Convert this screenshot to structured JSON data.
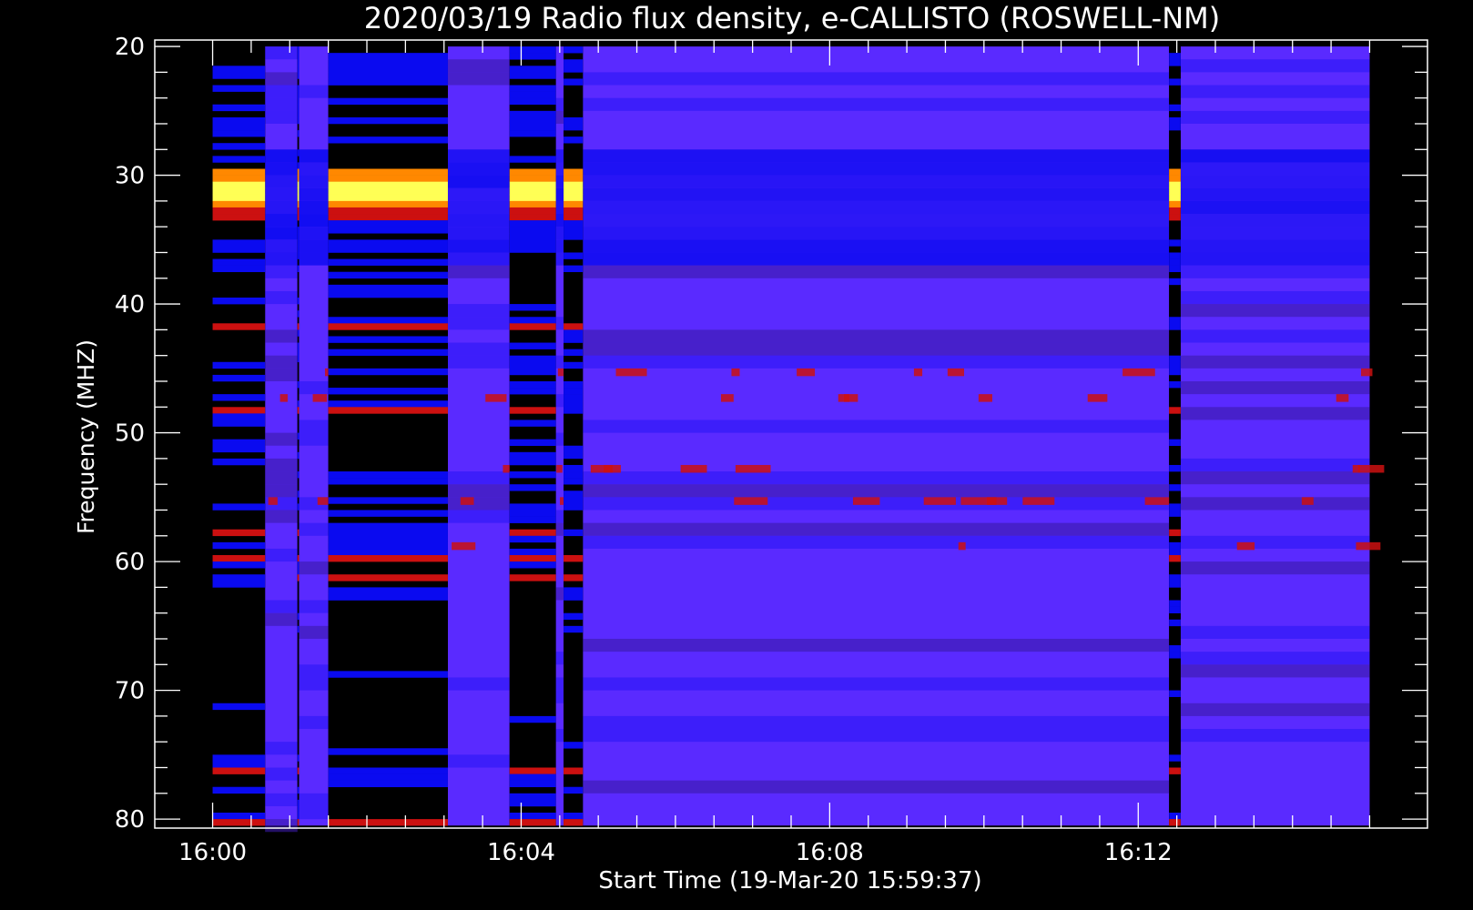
{
  "chart_data": {
    "type": "heatmap",
    "title": "2020/03/19  Radio flux density, e-CALLISTO (ROSWELL-NM)",
    "xlabel": "Start Time (19-Mar-20 15:59:37)",
    "ylabel": "Frequency (MHZ)",
    "x_start_minutes": 0,
    "x_end_minutes": 15,
    "xlim_minutes": [
      -0.75,
      15.75
    ],
    "x_ticks": [
      {
        "value": 0,
        "label": "16:00"
      },
      {
        "value": 4,
        "label": "16:04"
      },
      {
        "value": 8,
        "label": "16:08"
      },
      {
        "value": 12,
        "label": "16:12"
      }
    ],
    "ylim": [
      80.7,
      19.5
    ],
    "y_ticks": [
      20,
      30,
      40,
      50,
      60,
      70,
      80
    ],
    "y_range_MHz": [
      20,
      80.5
    ],
    "colormap": [
      "#000000",
      "#0a0af0",
      "#5a2aff",
      "#cc1010",
      "#ff8800",
      "#ffff55"
    ],
    "quiet_segments": [
      {
        "start": 0.68,
        "end": 1.1
      },
      {
        "start": 1.12,
        "end": 1.5
      },
      {
        "start": 3.05,
        "end": 3.85
      },
      {
        "start": 4.45,
        "end": 4.55
      },
      {
        "start": 4.8,
        "end": 12.4
      },
      {
        "start": 12.55,
        "end": 15.0
      }
    ],
    "active_segments": [
      {
        "start": 0.0,
        "end": 0.68
      },
      {
        "start": 1.1,
        "end": 1.12
      },
      {
        "start": 1.5,
        "end": 3.05
      },
      {
        "start": 3.85,
        "end": 4.45
      },
      {
        "start": 4.55,
        "end": 4.8
      },
      {
        "start": 12.4,
        "end": 12.55
      }
    ],
    "bright_band_MHz": [
      29.5,
      32.5
    ],
    "active_red_bands_MHz": [
      41.5,
      48,
      57.5,
      59.5,
      61,
      76,
      80
    ],
    "quiet_red_bands_MHz": [
      45,
      47,
      52.5,
      55,
      58.5
    ]
  }
}
